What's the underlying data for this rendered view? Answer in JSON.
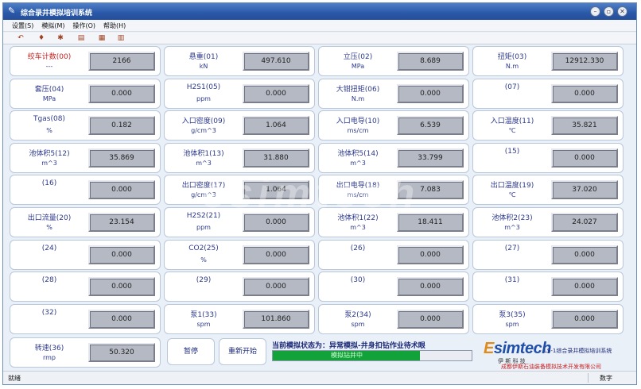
{
  "window": {
    "title": "综合录井模拟培训系统",
    "controls": [
      "minimize",
      "restore",
      "close"
    ]
  },
  "menu": [
    "设置(S)",
    "模拟(M)",
    "操作(O)",
    "帮助(H)"
  ],
  "toolbar_icons": [
    "undo-icon",
    "tool-icon",
    "settings-icon",
    "chart-icon",
    "grid-icon",
    "building-icon"
  ],
  "cells": [
    {
      "name": "绞车计数(00)",
      "unit": "---",
      "value": "2166",
      "red": true
    },
    {
      "name": "悬重(01)",
      "unit": "kN",
      "value": "497.610"
    },
    {
      "name": "立压(02)",
      "unit": "MPa",
      "value": "8.689"
    },
    {
      "name": "扭矩(03)",
      "unit": "N.m",
      "value": "12912.330"
    },
    {
      "name": "套压(04)",
      "unit": "MPa",
      "value": "0.000"
    },
    {
      "name": "H2S1(05)",
      "unit": "ppm",
      "value": "0.000"
    },
    {
      "name": "大钳扭矩(06)",
      "unit": "N.m",
      "value": "0.000"
    },
    {
      "name": "(07)",
      "unit": "",
      "value": "0.000"
    },
    {
      "name": "Tgas(08)",
      "unit": "%",
      "value": "0.182"
    },
    {
      "name": "入口密度(09)",
      "unit": "g/cm^3",
      "value": "1.064"
    },
    {
      "name": "入口电导(10)",
      "unit": "ms/cm",
      "value": "6.539"
    },
    {
      "name": "入口温度(11)",
      "unit": "℃",
      "value": "35.821"
    },
    {
      "name": "池体积5(12)",
      "unit": "m^3",
      "value": "35.869"
    },
    {
      "name": "池体积1(13)",
      "unit": "m^3",
      "value": "31.880"
    },
    {
      "name": "池体积5(14)",
      "unit": "m^3",
      "value": "33.799"
    },
    {
      "name": "(15)",
      "unit": "",
      "value": "0.000"
    },
    {
      "name": "(16)",
      "unit": "",
      "value": "0.000"
    },
    {
      "name": "出口密度(17)",
      "unit": "g/cm^3",
      "value": "1.064"
    },
    {
      "name": "出口电导(18)",
      "unit": "ms/cm",
      "value": "7.083"
    },
    {
      "name": "出口温度(19)",
      "unit": "℃",
      "value": "37.020"
    },
    {
      "name": "出口流量(20)",
      "unit": "%",
      "value": "23.154"
    },
    {
      "name": "H2S2(21)",
      "unit": "ppm",
      "value": "0.000"
    },
    {
      "name": "池体积1(22)",
      "unit": "m^3",
      "value": "18.411"
    },
    {
      "name": "池体积2(23)",
      "unit": "m^3",
      "value": "24.027"
    },
    {
      "name": "(24)",
      "unit": "",
      "value": "0.000"
    },
    {
      "name": "CO2(25)",
      "unit": "%",
      "value": "0.000"
    },
    {
      "name": "(26)",
      "unit": "",
      "value": "0.000"
    },
    {
      "name": "(27)",
      "unit": "",
      "value": "0.000"
    },
    {
      "name": "(28)",
      "unit": "",
      "value": "0.000"
    },
    {
      "name": "(29)",
      "unit": "",
      "value": "0.000"
    },
    {
      "name": "(30)",
      "unit": "",
      "value": "0.000"
    },
    {
      "name": "(31)",
      "unit": "",
      "value": "0.000"
    },
    {
      "name": "(32)",
      "unit": "",
      "value": "0.000"
    },
    {
      "name": "泵1(33)",
      "unit": "spm",
      "value": "101.860"
    },
    {
      "name": "泵2(34)",
      "unit": "spm",
      "value": "0.000"
    },
    {
      "name": "泵3(35)",
      "unit": "spm",
      "value": "0.000"
    }
  ],
  "bottom": {
    "rpm_cell": {
      "name": "转速(36)",
      "unit": "rmp",
      "value": "50.320"
    },
    "pause_button": "暂停",
    "restart_button": "重新开始",
    "status_prefix": "当前模拟状态为：",
    "status_message": "异常模拟-井身扣钻作业待术眼",
    "progress_text": "模拟钻井中",
    "progress_fraction": 0.74
  },
  "logo": {
    "brand": "Esimtech",
    "sub": "伊 斯 科 技",
    "system": "LS-1综合录井模拟培训系统",
    "company": "成都伊斯石油装备模拟技术开发有限公司"
  },
  "statusbar": {
    "left": "就绪",
    "right": "数字"
  },
  "watermark": "esimtech"
}
